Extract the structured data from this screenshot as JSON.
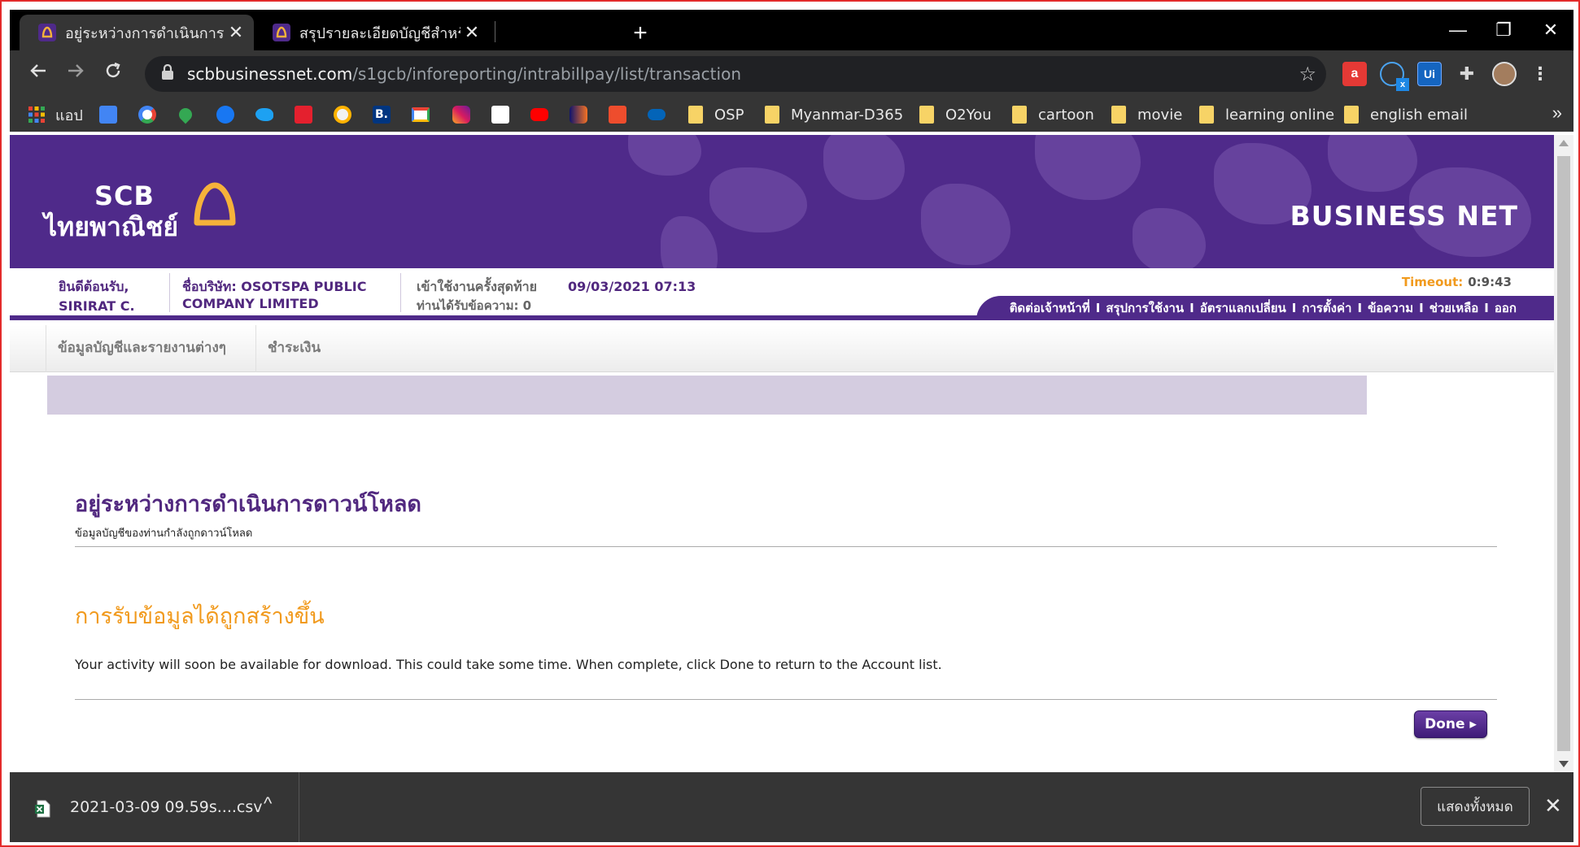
{
  "browser": {
    "tabs": [
      {
        "title": "อยู่ระหว่างการดำเนินการดาวน์โหลด - S",
        "close": "✕"
      },
      {
        "title": "สรุปรายละเอียดบัญชีสำหรับบริษัท - SC",
        "close": "✕"
      }
    ],
    "new_tab": "+",
    "window": {
      "minimize": "—",
      "restore": "❐",
      "close": "✕"
    },
    "url_host": "scbbusinessnet.com",
    "url_path": "/s1gcb/inforeporting/intrabillpay/list/transaction",
    "bookmarks": {
      "apps_label": "แอป",
      "folders": [
        "OSP",
        "Myanmar-D365",
        "O2You",
        "cartoon",
        "movie",
        "learning online",
        "english email"
      ],
      "more": "»"
    },
    "extensions": [
      "a",
      "Ui"
    ]
  },
  "header": {
    "logo_word": "SCB",
    "logo_thai": "ไทยพาณิชย์",
    "product": "BUSINESS NET"
  },
  "info": {
    "welcome_label": "ยินดีต้อนรับ,",
    "user": "SIRIRAT C.",
    "company_label": "ชื่อบริษัท: OSOTSPA PUBLIC",
    "company_line2": "COMPANY LIMITED",
    "last_login_label": "เข้าใช้งานครั้งสุดท้าย",
    "last_login_value": "09/03/2021 07:13",
    "messages_label": "ท่านได้รับข้อความ: 0",
    "timeout_label": "Timeout:",
    "timeout_value": "0:9:43",
    "menu": [
      "ติดต่อเจ้าหน้าที่",
      "สรุปการใช้งาน",
      "อัตราแลกเปลี่ยน",
      "การตั้งค่า",
      "ข้อความ",
      "ช่วยเหลือ",
      "ออก"
    ],
    "menu_sep": "I"
  },
  "nav": {
    "items": [
      "ข้อมูลบัญชีและรายงานต่างๆ",
      "ชำระเงิน"
    ]
  },
  "content": {
    "title": "อยู่ระหว่างการดำเนินการดาวน์โหลด",
    "subtitle": "ข้อมูลบัญชีของท่านกำลังถูกดาวน์โหลด",
    "status_title": "การรับข้อมูลได้ถูกสร้างขึ้น",
    "status_message": "Your activity will soon be available for download. This could take some time. When complete, click Done to return to the Account list.",
    "done_label": "Done ▸"
  },
  "downloads": {
    "file": "2021-03-09 09.59s....csv",
    "caret": "^",
    "show_all": "แสดงทั้งหมด",
    "close": "✕"
  },
  "colors": {
    "brand_purple": "#4f2a8a",
    "accent_orange": "#f19a1d",
    "lavender": "#d4cce0"
  }
}
